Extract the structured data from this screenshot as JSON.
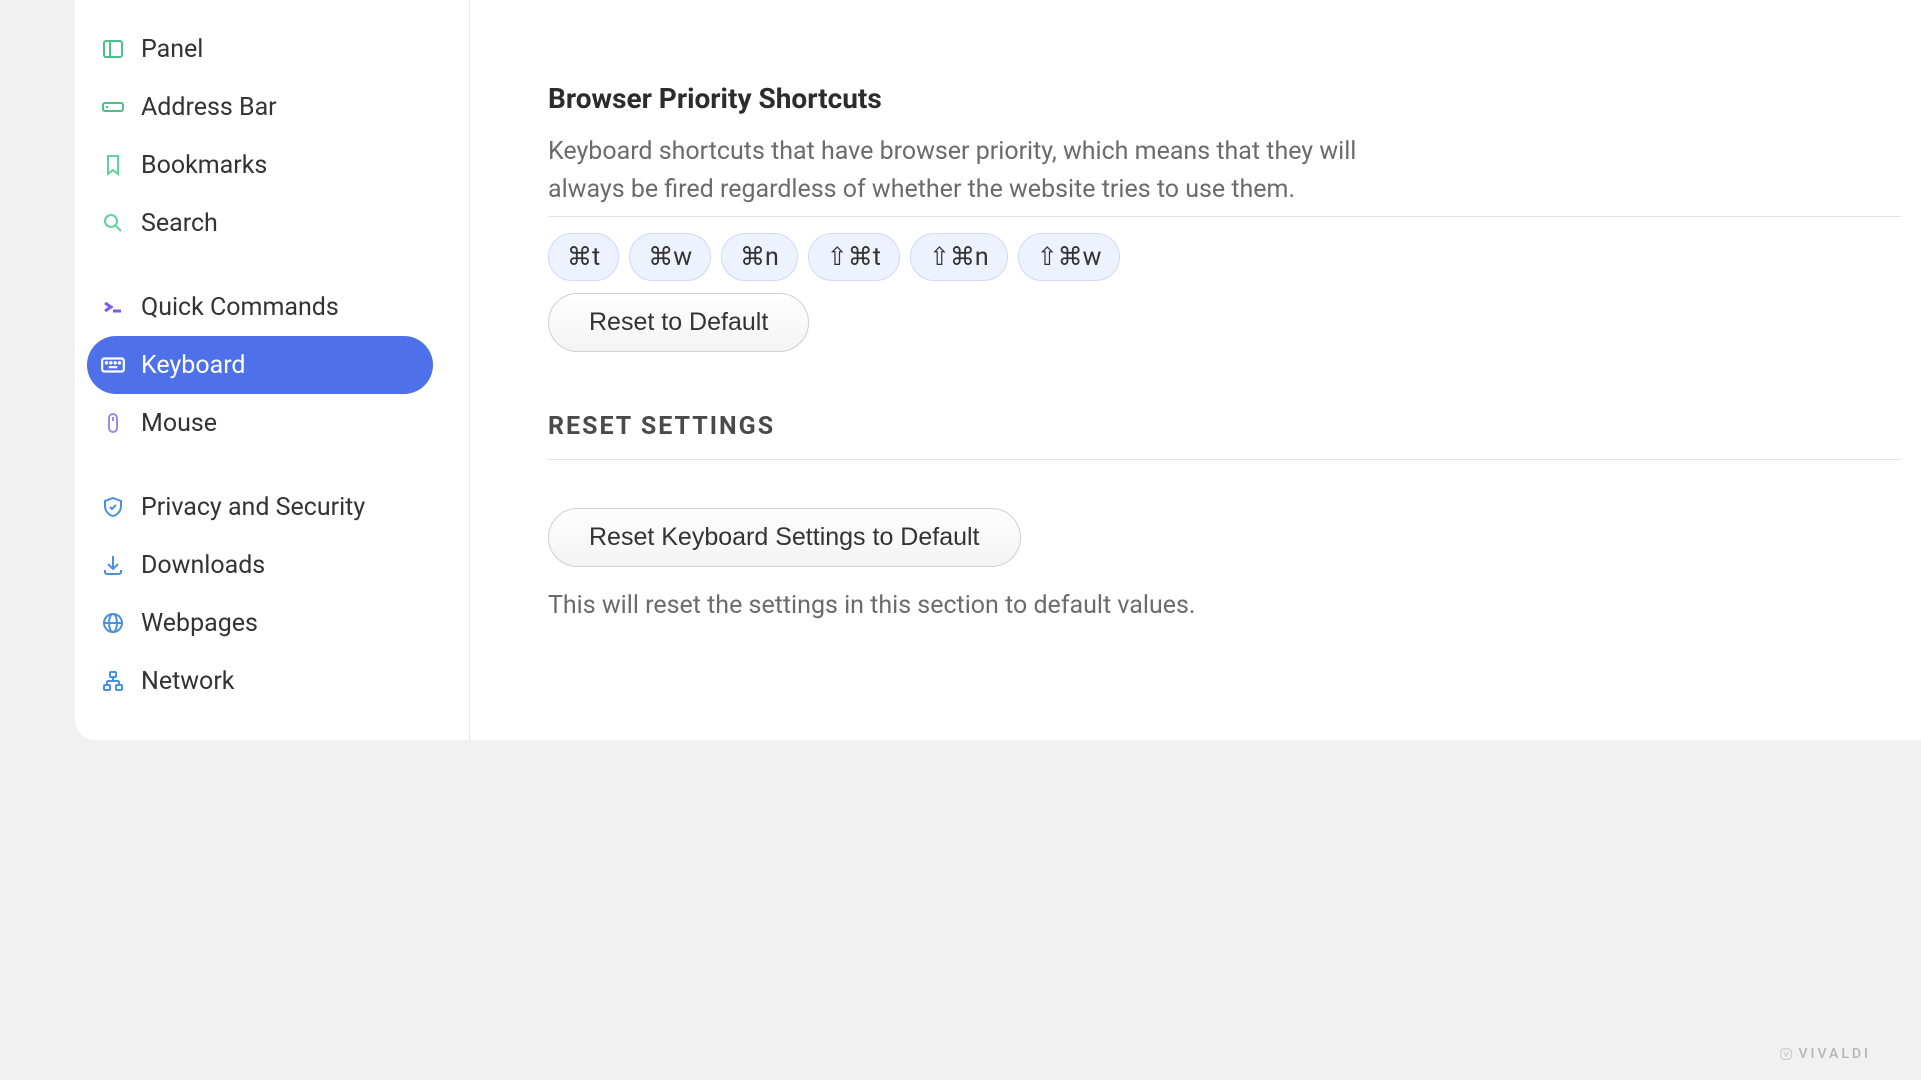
{
  "sidebar": {
    "items": [
      {
        "id": "panel",
        "label": "Panel",
        "icon": "panel-icon"
      },
      {
        "id": "address-bar",
        "label": "Address Bar",
        "icon": "address-bar-icon"
      },
      {
        "id": "bookmarks",
        "label": "Bookmarks",
        "icon": "bookmark-icon"
      },
      {
        "id": "search",
        "label": "Search",
        "icon": "search-icon"
      },
      {
        "id": "quick-commands",
        "label": "Quick Commands",
        "icon": "command-icon"
      },
      {
        "id": "keyboard",
        "label": "Keyboard",
        "icon": "keyboard-icon",
        "active": true
      },
      {
        "id": "mouse",
        "label": "Mouse",
        "icon": "mouse-icon"
      },
      {
        "id": "privacy",
        "label": "Privacy and Security",
        "icon": "shield-icon"
      },
      {
        "id": "downloads",
        "label": "Downloads",
        "icon": "download-icon"
      },
      {
        "id": "webpages",
        "label": "Webpages",
        "icon": "globe-icon"
      },
      {
        "id": "network",
        "label": "Network",
        "icon": "network-icon"
      }
    ]
  },
  "main": {
    "priority_shortcuts": {
      "title": "Browser Priority Shortcuts",
      "description": "Keyboard shortcuts that have browser priority, which means that they will always be fired regardless of whether the website tries to use them.",
      "pills": [
        "⌘t",
        "⌘w",
        "⌘n",
        "⇧⌘t",
        "⇧⌘n",
        "⇧⌘w"
      ],
      "reset_btn": "Reset to Default"
    },
    "reset_section": {
      "heading": "RESET SETTINGS",
      "button": "Reset Keyboard Settings to Default",
      "description": "This will reset the settings in this section to default values."
    }
  },
  "brand": "VIVALDI"
}
